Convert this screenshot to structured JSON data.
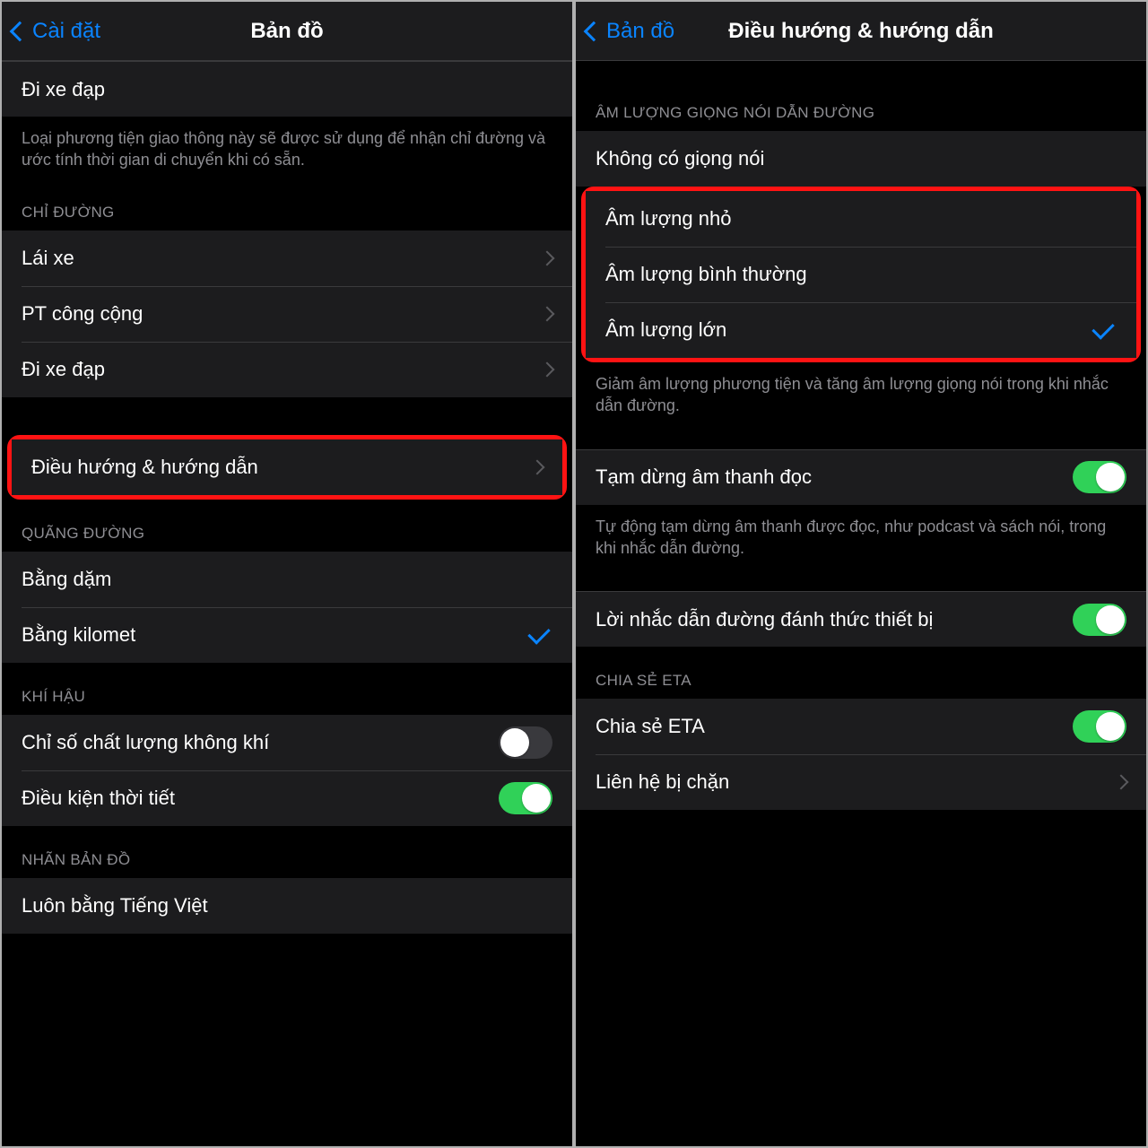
{
  "left": {
    "back": "Cài đặt",
    "title": "Bản đồ",
    "cycling": "Đi xe đạp",
    "cyclingFooter": "Loại phương tiện giao thông này sẽ được sử dụng để nhận chỉ đường và ước tính thời gian di chuyển khi có sẵn.",
    "directionsHeader": "CHỈ ĐƯỜNG",
    "driving": "Lái xe",
    "transit": "PT công cộng",
    "cycling2": "Đi xe đạp",
    "navGuidance": "Điều hướng & hướng dẫn",
    "distanceHeader": "QUÃNG ĐƯỜNG",
    "miles": "Bằng dặm",
    "kilometers": "Bằng kilomet",
    "climateHeader": "KHÍ HẬU",
    "aqi": "Chỉ số chất lượng không khí",
    "weather": "Điều kiện thời tiết",
    "mapLabelsHeader": "NHÃN BẢN ĐỒ",
    "alwaysViet": "Luôn bằng Tiếng Việt"
  },
  "right": {
    "back": "Bản đồ",
    "title": "Điều hướng & hướng dẫn",
    "volumeHeader": "ÂM LƯỢNG GIỌNG NÓI DẪN ĐƯỜNG",
    "noVoice": "Không có giọng nói",
    "lowVolume": "Âm lượng nhỏ",
    "normalVolume": "Âm lượng bình thường",
    "loudVolume": "Âm lượng lớn",
    "volumeFooter": "Giảm âm lượng phương tiện và tăng âm lượng giọng nói trong khi nhắc dẫn đường.",
    "pauseSpoken": "Tạm dừng âm thanh đọc",
    "pauseSpokenFooter": "Tự động tạm dừng âm thanh được đọc, như podcast và sách nói, trong khi nhắc dẫn đường.",
    "wakeDevice": "Lời nhắc dẫn đường đánh thức thiết bị",
    "etaHeader": "CHIA SẺ ETA",
    "shareEta": "Chia sẻ ETA",
    "blocked": "Liên hệ bị chặn"
  }
}
